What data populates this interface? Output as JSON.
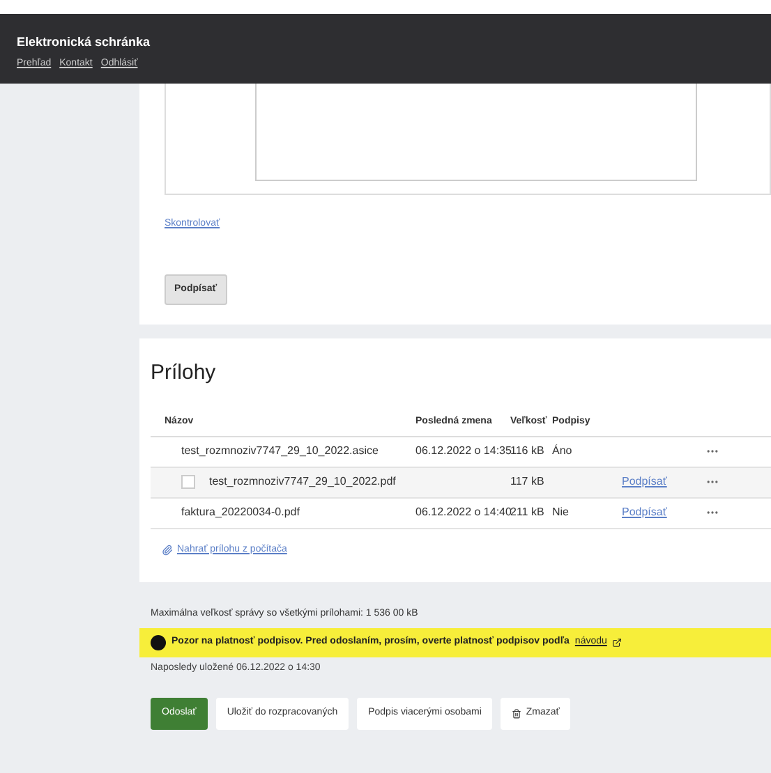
{
  "header": {
    "title": "Elektronická schránka",
    "nav": [
      "Prehľad",
      "Kontakt",
      "Odhlásiť"
    ]
  },
  "editor": {
    "link": "Skontrolovať",
    "sign_button": "Podpísať"
  },
  "attachments": {
    "title": "Prílohy",
    "columns": [
      "Názov",
      "Posledná zmena",
      "Veľkosť",
      "Podpisy"
    ],
    "rows": [
      {
        "name": "test_rozmnoziv7747_29_10_2022.asice",
        "changed": "06.12.2022 o 14:35",
        "size": "116 kB",
        "signed": "Áno",
        "children": [
          {
            "name": "test_rozmnoziv7747_29_10_2022.pdf",
            "checked": false,
            "size": "117 kB",
            "action": "Podpísať"
          }
        ]
      },
      {
        "name": "faktura_20220034-0.pdf",
        "changed": "06.12.2022 o 14:40",
        "size": "211 kB",
        "signed": "Nie",
        "action": "Podpísať"
      }
    ],
    "upload_link": "Nahrať prílohu z počítača"
  },
  "max_size": "Maximálna veľkosť správy so všetkými prílohami: 1 536 00 kB",
  "warning": {
    "text": "Pozor na platnosť podpisov. Pred odoslaním, prosím, overte platnosť podpisov podľa",
    "link": "návodu"
  },
  "saved": "Naposledy uložené 06.12.2022 o 14:30",
  "actions": [
    {
      "label": "Odoslať",
      "kind": "primary"
    },
    {
      "label": "Uložiť do rozpracovaných",
      "kind": "secondary"
    },
    {
      "label": "Podpis viacerými osobami",
      "kind": "secondary"
    },
    {
      "label": "Zmazať",
      "kind": "delete"
    }
  ]
}
